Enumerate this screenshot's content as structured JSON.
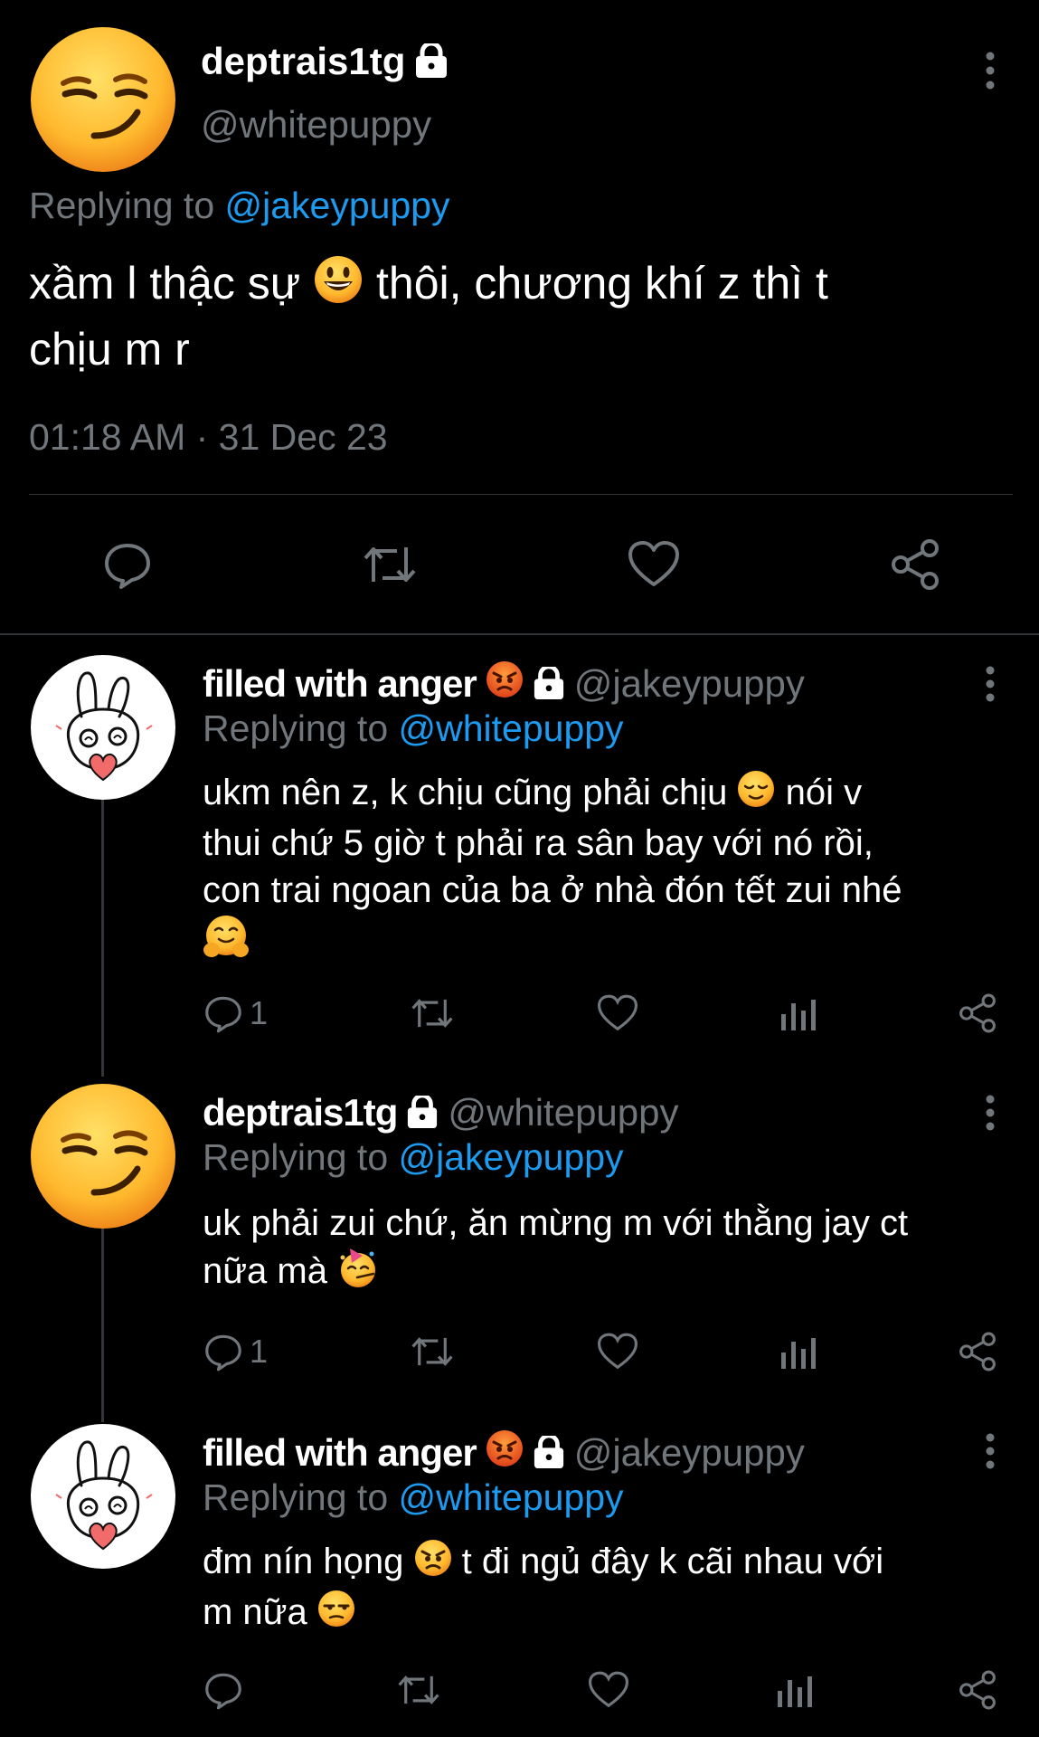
{
  "main_tweet": {
    "display_name": "deptrais1tg",
    "handle": "@whitepuppy",
    "replying_prefix": "Replying to ",
    "replying_to": "@jakeypuppy",
    "text_part1": "xầm l thậc sự",
    "text_part2": " thôi, chương khí z thì t",
    "text_line2": "chịu m r",
    "timestamp": "01:18 AM · 31 Dec 23"
  },
  "replies": [
    {
      "display_name": "filled with anger",
      "handle": "@jakeypuppy",
      "replying_prefix": "Replying to ",
      "replying_to": "@whitepuppy",
      "line1_a": "ukm nên z, k chịu cũng phải chịu",
      "line1_b": " nói v",
      "line2": "thui chứ 5 giờ t phải ra sân bay với nó rồi,",
      "line3": "con trai ngoan của ba ở nhà đón tết zui nhé",
      "reply_count": "1"
    },
    {
      "display_name": "deptrais1tg",
      "handle": "@whitepuppy",
      "replying_prefix": "Replying to ",
      "replying_to": "@jakeypuppy",
      "line1": "uk phải zui chứ, ăn mừng m với thằng jay ct",
      "line2": "nữa mà",
      "reply_count": "1"
    },
    {
      "display_name": "filled with anger",
      "handle": "@jakeypuppy",
      "replying_prefix": "Replying to ",
      "replying_to": "@whitepuppy",
      "line1_a": "đm nín họng",
      "line1_b": " t đi ngủ đây k cãi nhau với",
      "line2": "m nữa",
      "reply_count": ""
    }
  ],
  "colors": {
    "background": "#000000",
    "text": "#ffffff",
    "muted": "#71767b",
    "link": "#1d9bf0",
    "divider": "#2f3336"
  },
  "icons": [
    "smirk-emoji",
    "lock-icon",
    "more-icon",
    "reply-icon",
    "retweet-icon",
    "like-icon",
    "share-icon",
    "views-icon",
    "angry-emoji",
    "grinning-emoji",
    "relieved-emoji",
    "hugging-emoji",
    "party-emoji",
    "unamused-emoji",
    "bunny-avatar"
  ]
}
